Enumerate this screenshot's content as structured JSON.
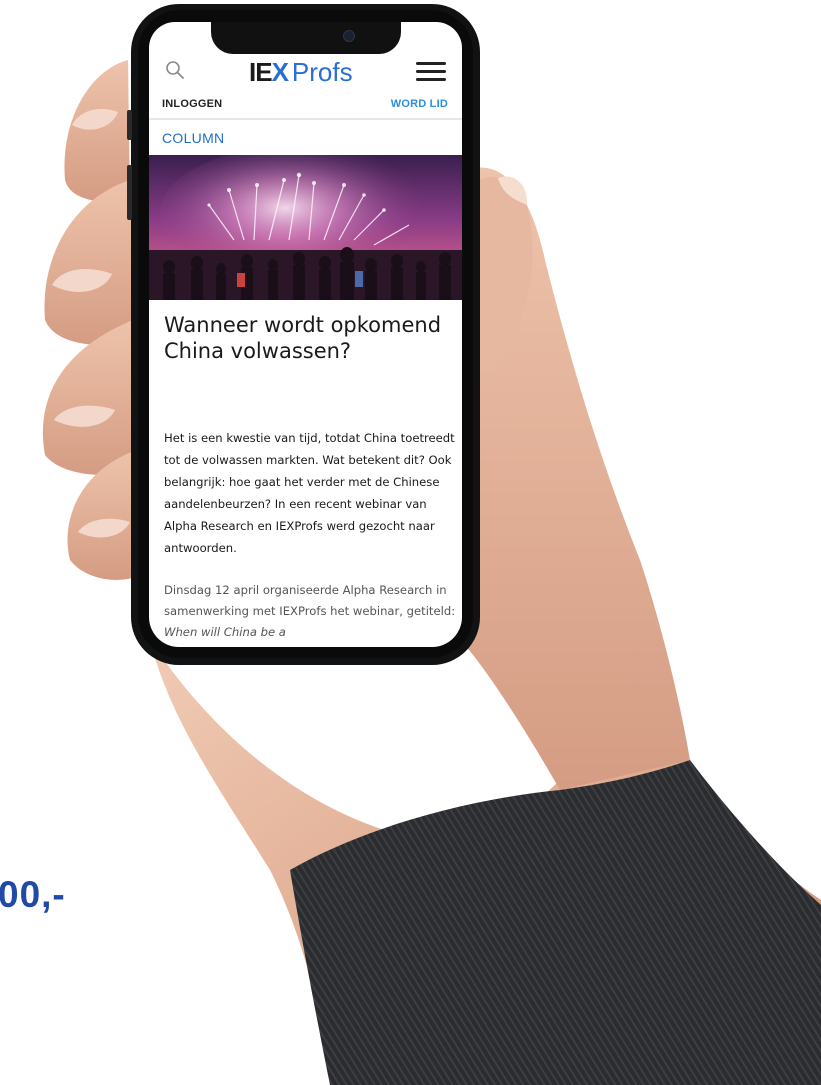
{
  "background": {
    "price_fragment": "00,-",
    "accent_color": "#1f4aa8"
  },
  "app": {
    "logo_part1": "IE",
    "logo_x": "X",
    "logo_part2": "Profs",
    "brand_color": "#2a6fd6",
    "icons": {
      "search": "search-icon",
      "menu": "hamburger-menu-icon"
    },
    "login_label": "INLOGGEN",
    "join_label": "WORD LID"
  },
  "article": {
    "category": "COLUMN",
    "title": "Wanneer wordt opkomend China volwassen?",
    "intro": "Het is een kwestie van tijd, totdat China toetreedt tot de volwassen markten. Wat betekent dit? Ook belangrijk: hoe gaat het verder met de Chinese aandelenbeurzen? In een recent webinar van Alpha Research en IEXProfs werd gezocht naar antwoorden.",
    "body_start": "Dinsdag 12 april organiseerde Alpha Research in samenwerking met IEXProfs het webinar, getiteld: ",
    "body_italic": "When will China be a"
  }
}
